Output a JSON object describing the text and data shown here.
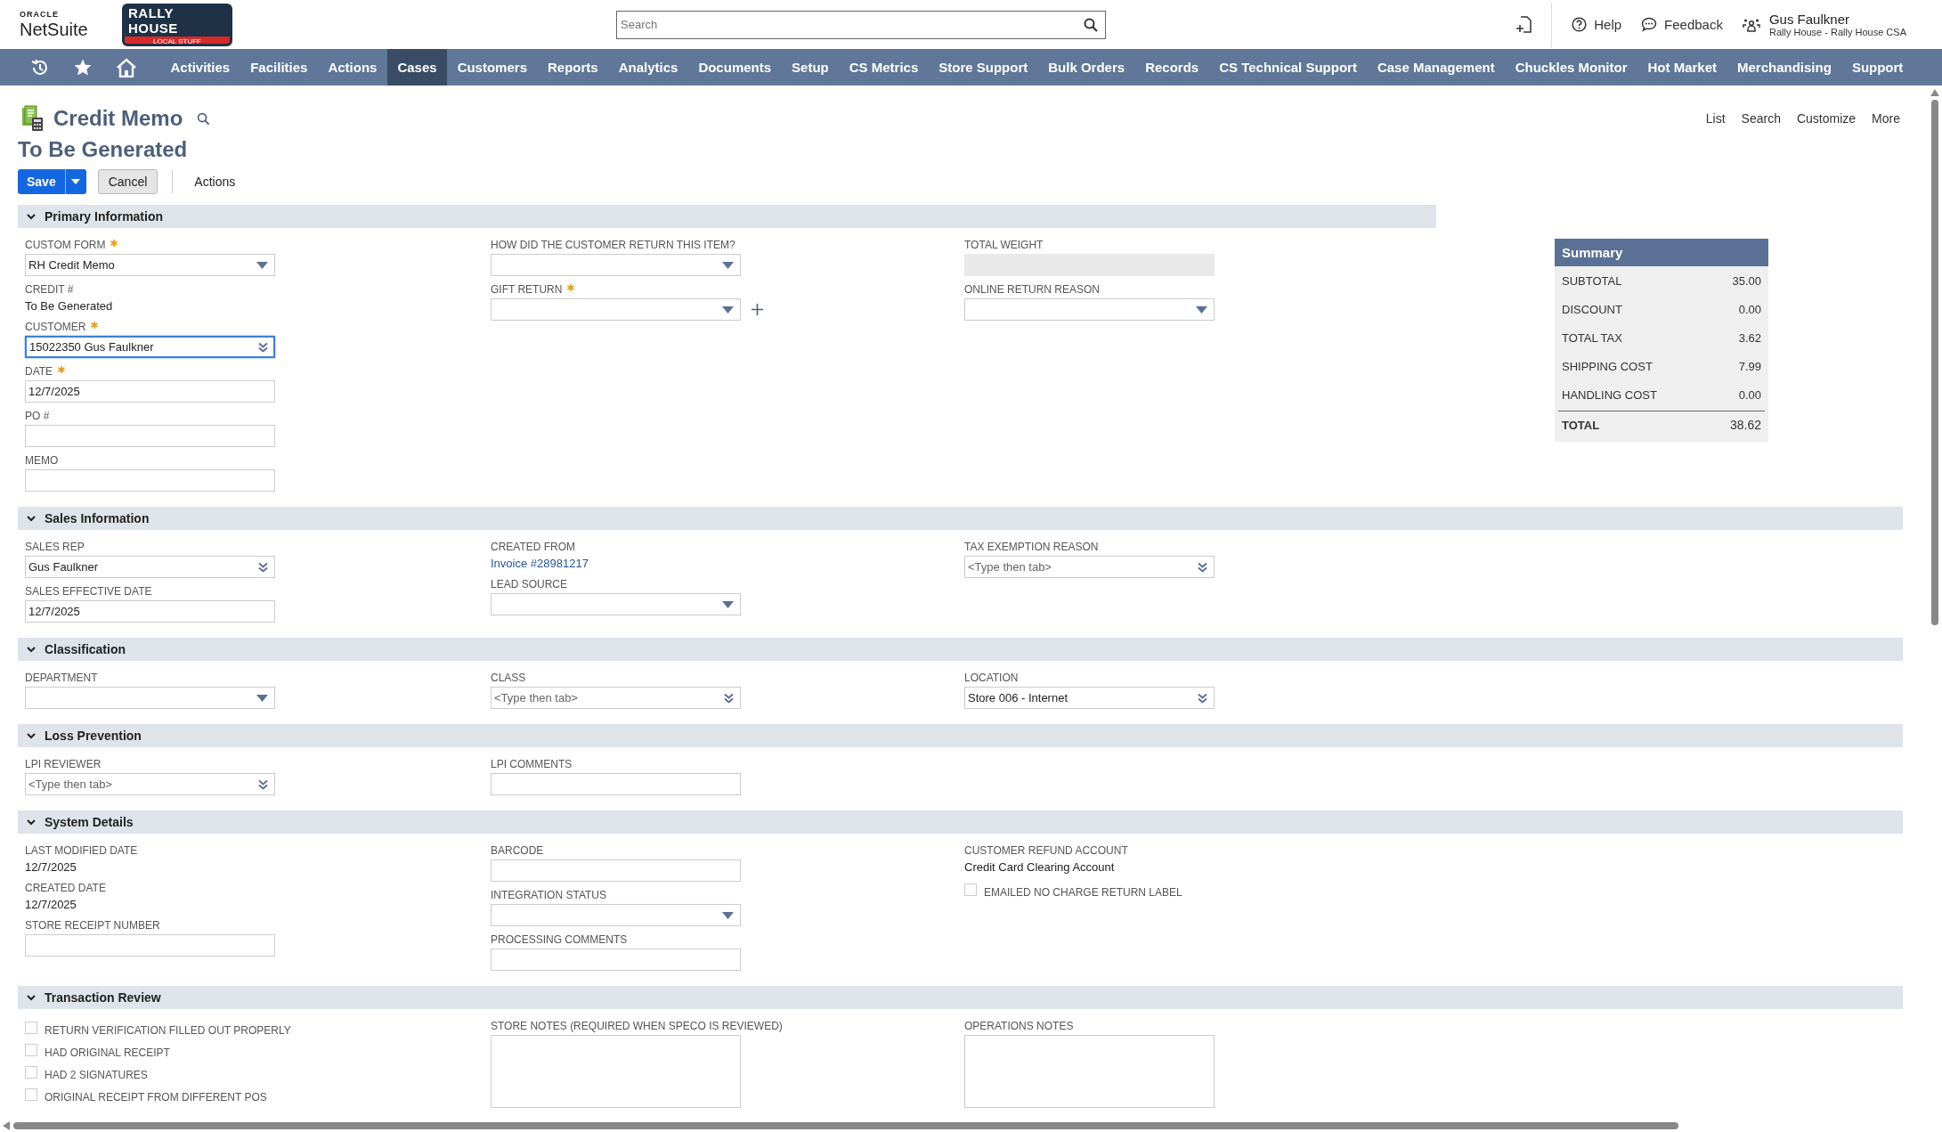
{
  "header": {
    "logo_top": "ORACLE",
    "logo": "NetSuite",
    "brand": "RALLY HOUSE",
    "brand_tagline": "LOCAL STUFF",
    "search": {
      "placeholder": "Search"
    },
    "links": [
      {
        "label": "Help",
        "kind": "help"
      },
      {
        "label": "Feedback",
        "kind": "feedback"
      }
    ],
    "user": {
      "name": "Gus Faulkner",
      "role": "Rally House - Rally House CSA"
    }
  },
  "nav": [
    {
      "label": "Activities",
      "selected": false
    },
    {
      "label": "Facilities",
      "selected": false
    },
    {
      "label": "Actions",
      "selected": false
    },
    {
      "label": "Cases",
      "selected": true
    },
    {
      "label": "Customers",
      "selected": false
    },
    {
      "label": "Reports",
      "selected": false
    },
    {
      "label": "Analytics",
      "selected": false
    },
    {
      "label": "Documents",
      "selected": false
    },
    {
      "label": "Setup",
      "selected": false
    },
    {
      "label": "CS Metrics",
      "selected": false
    },
    {
      "label": "Store Support",
      "selected": false
    },
    {
      "label": "Bulk Orders",
      "selected": false
    },
    {
      "label": "Records",
      "selected": false
    },
    {
      "label": "CS Technical Support",
      "selected": false
    },
    {
      "label": "Case Management",
      "selected": false
    },
    {
      "label": "Chuckles Monitor",
      "selected": false
    },
    {
      "label": "Hot Market",
      "selected": false
    },
    {
      "label": "Merchandising",
      "selected": false
    },
    {
      "label": "Support",
      "selected": false
    }
  ],
  "page": {
    "title": "Credit Memo",
    "subtitle": "To Be Generated",
    "links": [
      "List",
      "Search",
      "Customize",
      "More"
    ]
  },
  "buttons": {
    "save": "Save",
    "cancel": "Cancel",
    "actions": "Actions"
  },
  "sections": [
    {
      "title": "Primary Information",
      "expanded": true,
      "columns": [
        [
          {
            "kind": "select",
            "label": "CUSTOM FORM",
            "required": true,
            "value": "RH Credit Memo"
          },
          {
            "kind": "static",
            "label": "CREDIT #",
            "value": "To Be Generated"
          },
          {
            "kind": "lookup",
            "label": "CUSTOMER",
            "required": true,
            "value": "15022350 Gus Faulkner",
            "focused": true
          },
          {
            "kind": "text",
            "label": "DATE",
            "required": true,
            "value": "12/7/2025"
          },
          {
            "kind": "text",
            "label": "PO #"
          },
          {
            "kind": "text",
            "label": "MEMO"
          }
        ],
        [
          {
            "kind": "select",
            "label": "HOW DID THE CUSTOMER RETURN THIS ITEM?"
          },
          {
            "kind": "select",
            "label": "GIFT RETURN",
            "required": true,
            "addable": true
          }
        ],
        [
          {
            "kind": "disabled",
            "label": "TOTAL WEIGHT"
          },
          {
            "kind": "select",
            "label": "ONLINE RETURN REASON"
          }
        ]
      ]
    },
    {
      "title": "Sales Information",
      "expanded": true,
      "columns": [
        [
          {
            "kind": "lookup",
            "label": "SALES REP",
            "value": "Gus Faulkner"
          },
          {
            "kind": "text",
            "label": "SALES EFFECTIVE DATE",
            "value": "12/7/2025"
          }
        ],
        [
          {
            "kind": "link",
            "label": "CREATED FROM",
            "value": "Invoice #28981217"
          },
          {
            "kind": "select",
            "label": "LEAD SOURCE"
          }
        ],
        [
          {
            "kind": "lookup",
            "label": "TAX EXEMPTION REASON",
            "placeholder": "<Type then tab>"
          }
        ]
      ]
    },
    {
      "title": "Classification",
      "expanded": true,
      "columns": [
        [
          {
            "kind": "select",
            "label": "DEPARTMENT"
          }
        ],
        [
          {
            "kind": "lookup",
            "label": "CLASS",
            "placeholder": "<Type then tab>"
          }
        ],
        [
          {
            "kind": "lookup",
            "label": "LOCATION",
            "value": "Store 006 - Internet"
          }
        ]
      ]
    },
    {
      "title": "Loss Prevention",
      "expanded": true,
      "columns": [
        [
          {
            "kind": "lookup",
            "label": "LPI REVIEWER",
            "placeholder": "<Type then tab>"
          }
        ],
        [
          {
            "kind": "text",
            "label": "LPI COMMENTS"
          }
        ],
        []
      ]
    },
    {
      "title": "System Details",
      "expanded": true,
      "columns": [
        [
          {
            "kind": "static",
            "label": "LAST MODIFIED DATE",
            "value": "12/7/2025"
          },
          {
            "kind": "static",
            "label": "CREATED DATE",
            "value": "12/7/2025"
          },
          {
            "kind": "text",
            "label": "STORE RECEIPT NUMBER"
          }
        ],
        [
          {
            "kind": "text",
            "label": "BARCODE"
          },
          {
            "kind": "select",
            "label": "INTEGRATION STATUS"
          },
          {
            "kind": "text",
            "label": "PROCESSING COMMENTS"
          }
        ],
        [
          {
            "kind": "static",
            "label": "CUSTOMER REFUND ACCOUNT",
            "value": "Credit Card Clearing Account"
          },
          {
            "kind": "checkbox",
            "label": "EMAILED NO CHARGE RETURN LABEL",
            "checked": false
          }
        ]
      ]
    },
    {
      "title": "Transaction Review",
      "expanded": true,
      "columns": [
        [
          {
            "kind": "checkbox",
            "label": "RETURN VERIFICATION FILLED OUT PROPERLY",
            "checked": false
          },
          {
            "kind": "checkbox",
            "label": "HAD ORIGINAL RECEIPT",
            "checked": false
          },
          {
            "kind": "checkbox",
            "label": "HAD 2 SIGNATURES",
            "checked": false
          },
          {
            "kind": "checkbox",
            "label": "ORIGINAL RECEIPT FROM DIFFERENT POS",
            "checked": false
          }
        ],
        [
          {
            "kind": "textarea",
            "label": "STORE NOTES (REQUIRED WHEN SPECO IS REVIEWED)"
          }
        ],
        [
          {
            "kind": "textarea",
            "label": "OPERATIONS NOTES"
          }
        ]
      ]
    }
  ],
  "summary": {
    "title": "Summary",
    "rows": [
      {
        "label": "SUBTOTAL",
        "value": "35.00",
        "kind": "line"
      },
      {
        "label": "DISCOUNT",
        "value": "0.00",
        "kind": "line"
      },
      {
        "label": "TOTAL TAX",
        "value": "3.62",
        "kind": "line"
      },
      {
        "label": "SHIPPING COST",
        "value": "7.99",
        "kind": "line"
      },
      {
        "label": "HANDLING COST",
        "value": "0.00",
        "kind": "line"
      },
      {
        "label": "TOTAL",
        "value": "38.62",
        "kind": "total"
      }
    ]
  }
}
